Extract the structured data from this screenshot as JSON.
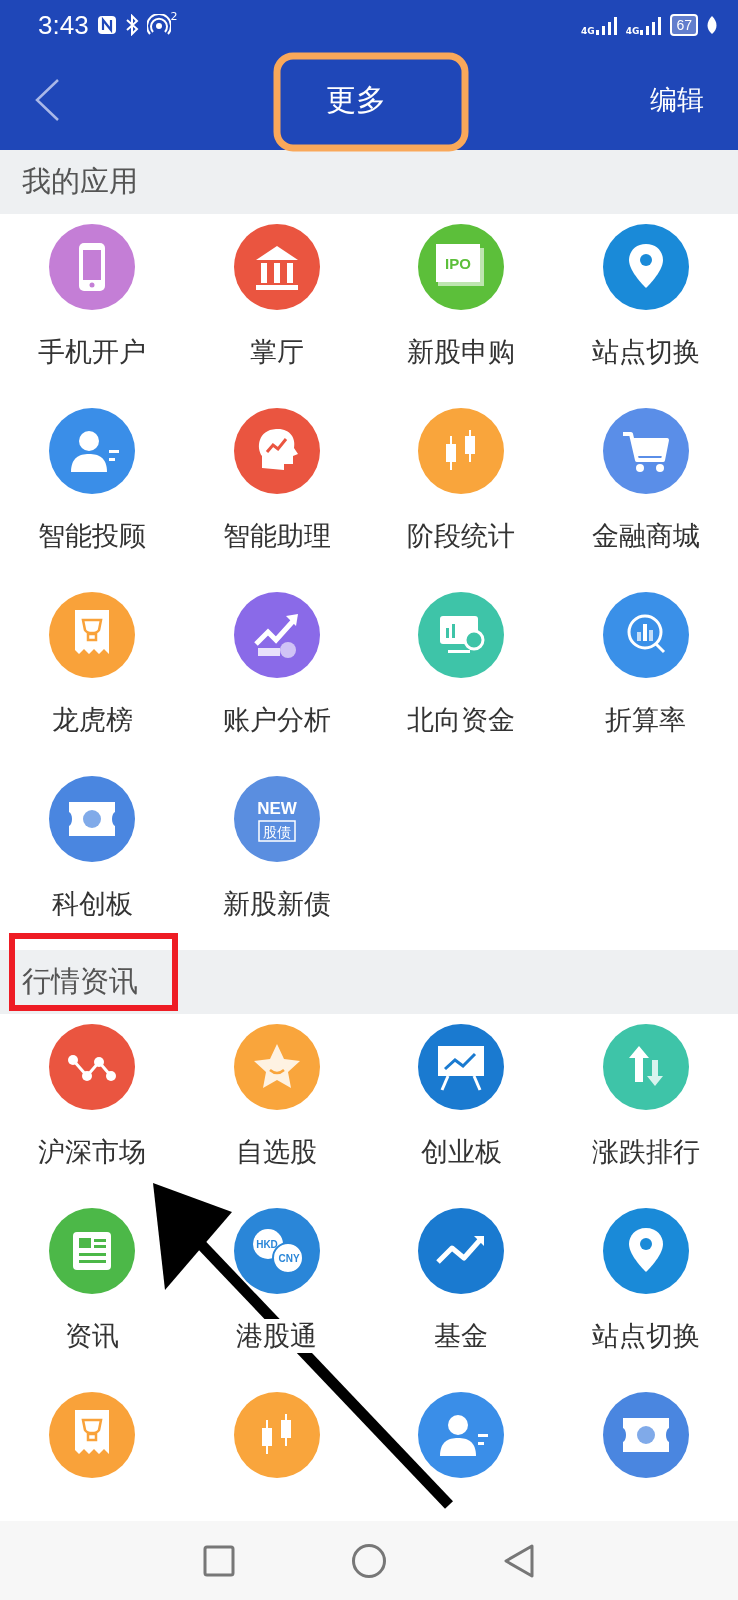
{
  "status_bar": {
    "time": "3:43",
    "hotspot_badge": "2",
    "network_labels": [
      "4G",
      "4G"
    ],
    "battery": "67"
  },
  "header": {
    "title": "更多",
    "action": "编辑"
  },
  "sections": [
    {
      "title": "我的应用",
      "items": [
        {
          "label": "手机开户",
          "kind": "phone",
          "color": "#c47ed6"
        },
        {
          "label": "掌厅",
          "kind": "bank",
          "color": "#ea5540"
        },
        {
          "label": "新股申购",
          "kind": "ipo",
          "color": "#5cbf3a",
          "icon_text": [
            "IPO"
          ]
        },
        {
          "label": "站点切换",
          "kind": "pin",
          "color": "#1a8ad8"
        },
        {
          "label": "智能投顾",
          "kind": "advisor",
          "color": "#3a8ee8"
        },
        {
          "label": "智能助理",
          "kind": "brain",
          "color": "#ea5540"
        },
        {
          "label": "阶段统计",
          "kind": "candles",
          "color": "#f9a53c"
        },
        {
          "label": "金融商城",
          "kind": "cart",
          "color": "#5a8ee8"
        },
        {
          "label": "龙虎榜",
          "kind": "trophy",
          "color": "#f9a23a"
        },
        {
          "label": "账户分析",
          "kind": "growth",
          "color": "#8a6ae8"
        },
        {
          "label": "北向资金",
          "kind": "monitor",
          "color": "#3ec4a8"
        },
        {
          "label": "折算率",
          "kind": "magnifier",
          "color": "#3a90e8"
        },
        {
          "label": "科创板",
          "kind": "ticket",
          "color": "#4a86e0"
        },
        {
          "label": "新股新债",
          "kind": "new",
          "color": "#5a8ee0",
          "icon_text": [
            "NEW",
            "股债"
          ]
        }
      ]
    },
    {
      "title": "行情资讯",
      "items": [
        {
          "label": "沪深市场",
          "kind": "zigzag",
          "color": "#ea5540"
        },
        {
          "label": "自选股",
          "kind": "star",
          "color": "#f9a53c"
        },
        {
          "label": "创业板",
          "kind": "easel",
          "color": "#1a7ad0"
        },
        {
          "label": "涨跌排行",
          "kind": "updown",
          "color": "#3ec4a8"
        },
        {
          "label": "资讯",
          "kind": "news",
          "color": "#4cb848"
        },
        {
          "label": "港股通",
          "kind": "currency",
          "color": "#2a86d8",
          "icon_text": [
            "HKD",
            "CNY"
          ]
        },
        {
          "label": "基金",
          "kind": "trend",
          "color": "#1a7ad0"
        },
        {
          "label": "站点切换",
          "kind": "pin",
          "color": "#1a8ad8"
        },
        {
          "kind": "trophy",
          "color": "#f9a23a"
        },
        {
          "kind": "candles",
          "color": "#f9a53c"
        },
        {
          "kind": "advisor",
          "color": "#3a8ee8"
        },
        {
          "kind": "ticket",
          "color": "#4a86e0"
        }
      ]
    }
  ],
  "annotations": [
    {
      "kind": "title_frame"
    },
    {
      "kind": "section_frame"
    },
    {
      "kind": "arrow"
    }
  ]
}
